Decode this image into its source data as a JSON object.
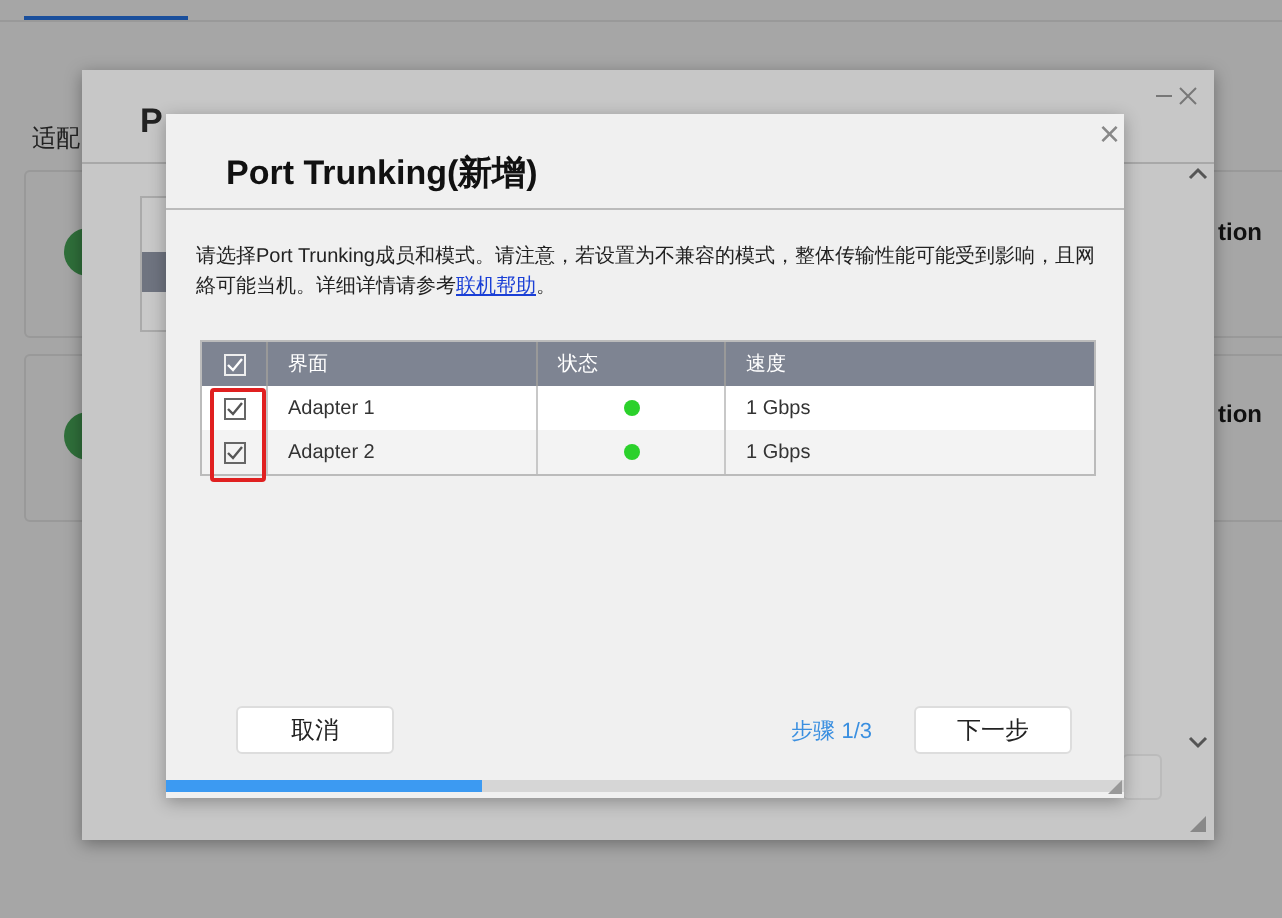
{
  "background_page": {
    "tabs": [
      {
        "selected": true
      }
    ],
    "section_label": "适配",
    "cards": [
      {
        "label": "tion"
      },
      {
        "label": "tion"
      }
    ]
  },
  "middle_dialog": {
    "title": "P"
  },
  "dialog": {
    "title": "Port Trunking(新增)",
    "close": "×",
    "description": "请选择Port Trunking成员和模式。请注意，若设置为不兼容的模式，整体传输性能可能受到影响，且网絡可能当机。详细详情请参考",
    "help_link": "联机帮助",
    "description_end": "。",
    "table": {
      "select_all_checked": true,
      "highlighted": true,
      "columns": [
        "界面",
        "状态",
        "速度"
      ],
      "rows": [
        {
          "checked": true,
          "name": "Adapter 1",
          "connected": true,
          "speed": "1 Gbps"
        },
        {
          "checked": true,
          "name": "Adapter 2",
          "connected": true,
          "speed": "1 Gbps"
        }
      ]
    },
    "cancel": "取消",
    "step": "步骤 1/3",
    "next": "下一步",
    "progress": {
      "level": 0.33
    }
  }
}
